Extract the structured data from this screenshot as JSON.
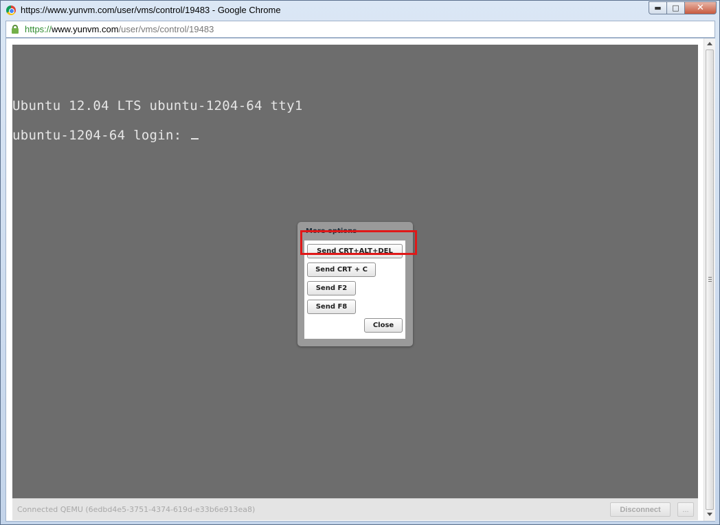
{
  "window": {
    "title": "https://www.yunvm.com/user/vms/control/19483 - Google Chrome",
    "minimize_label": "▬",
    "maximize_label": "□",
    "close_label": "✕"
  },
  "address": {
    "scheme": "https://",
    "host": "www.yunvm.com",
    "path": "/user/vms/control/19483"
  },
  "console": {
    "line1": "Ubuntu 12.04 LTS ubuntu-1204-64 tty1",
    "line2": "ubuntu-1204-64 login: "
  },
  "status": {
    "text": "Connected QEMU (6edbd4e5-3751-4374-619d-e33b6e913ea8)",
    "disconnect_label": "Disconnect",
    "more_label": "..."
  },
  "modal": {
    "title": "More options",
    "buttons": {
      "ctrl_alt_del": "Send CRT+ALT+DEL",
      "ctrl_c": "Send CRT + C",
      "f2": "Send F2",
      "f8": "Send F8",
      "close": "Close"
    }
  },
  "colors": {
    "console_bg": "#6d6d6d",
    "highlight": "#e01818",
    "secure_scheme": "#2e8b2e"
  },
  "icons": [
    "chrome-icon",
    "lock-icon",
    "scroll-up-icon",
    "scroll-down-icon"
  ]
}
